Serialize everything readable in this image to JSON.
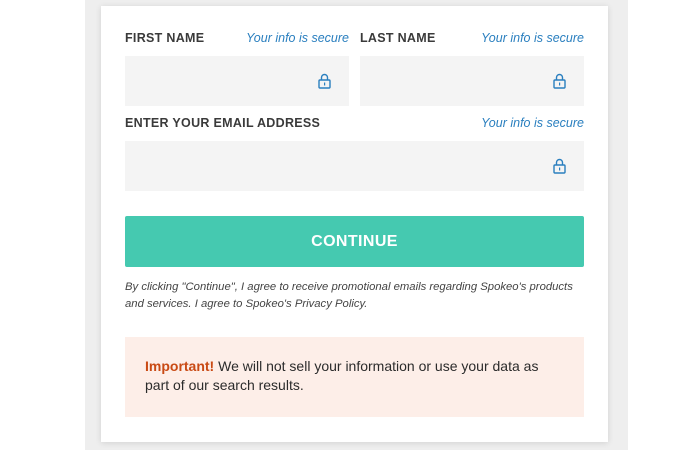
{
  "form": {
    "first_name": {
      "label": "FIRST NAME",
      "secure_note": "Your info is secure",
      "value": ""
    },
    "last_name": {
      "label": "LAST NAME",
      "secure_note": "Your info is secure",
      "value": ""
    },
    "email": {
      "label": "ENTER YOUR EMAIL ADDRESS",
      "secure_note": "Your info is secure",
      "value": ""
    },
    "field_icon": "lock-icon",
    "continue_label": "CONTINUE",
    "legal_text": "By clicking \"Continue\", I agree to receive promotional emails regarding Spokeo's products and services. I agree to Spokeo's Privacy Policy."
  },
  "notice": {
    "important_label": "Important!",
    "text": " We will not sell your information or use your data as part of our search results."
  },
  "colors": {
    "accent_button": "#45c9b0",
    "secure_note": "#2a7fbf",
    "field_background": "#f4f4f4",
    "notice_background": "#fdeee8",
    "important_text": "#c94a14"
  }
}
